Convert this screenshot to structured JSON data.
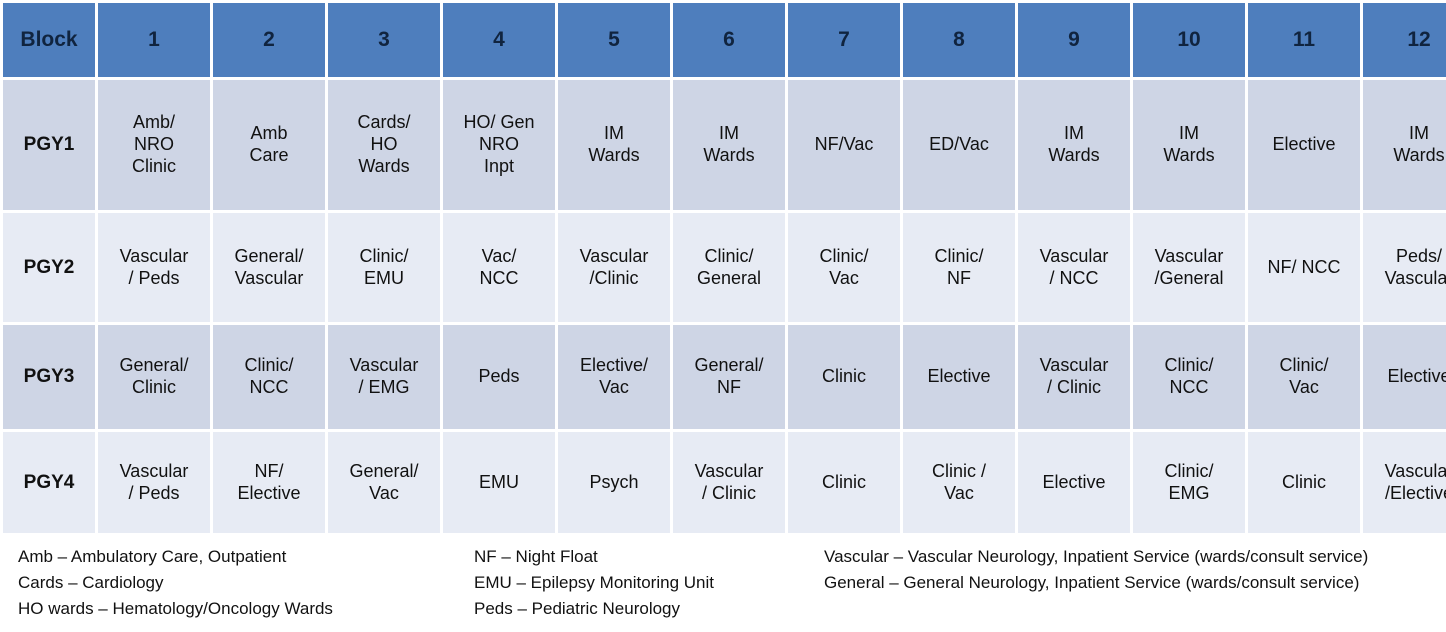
{
  "table": {
    "corner_label": "Block",
    "block_numbers": [
      "1",
      "2",
      "3",
      "4",
      "5",
      "6",
      "7",
      "8",
      "9",
      "10",
      "11",
      "12"
    ],
    "header_bg": "#4e7ebd",
    "band_dark_bg": "#ced5e5",
    "band_light_bg": "#e7ebf4",
    "rows": [
      {
        "label": "PGY1",
        "band": "dark",
        "cells": [
          [
            "Amb/",
            "NRO",
            "Clinic"
          ],
          [
            "Amb",
            "Care"
          ],
          [
            "Cards/",
            "HO",
            "Wards"
          ],
          [
            "HO/ Gen",
            "NRO",
            "Inpt"
          ],
          [
            "IM",
            "Wards"
          ],
          [
            "IM",
            "Wards"
          ],
          [
            "NF/Vac"
          ],
          [
            "ED/Vac"
          ],
          [
            "IM",
            "Wards"
          ],
          [
            "IM",
            "Wards"
          ],
          [
            "Elective"
          ],
          [
            "IM",
            "Wards"
          ]
        ]
      },
      {
        "label": "PGY2",
        "band": "light",
        "cells": [
          [
            "Vascular",
            "/ Peds"
          ],
          [
            "General/",
            "Vascular"
          ],
          [
            "Clinic/",
            "EMU"
          ],
          [
            "Vac/",
            "NCC"
          ],
          [
            "Vascular",
            "/Clinic"
          ],
          [
            "Clinic/",
            "General"
          ],
          [
            "Clinic/",
            "Vac"
          ],
          [
            "Clinic/",
            "NF"
          ],
          [
            "Vascular",
            "/ NCC"
          ],
          [
            "Vascular",
            "/General"
          ],
          [
            "NF/ NCC"
          ],
          [
            "Peds/",
            "Vascular"
          ]
        ]
      },
      {
        "label": "PGY3",
        "band": "dark",
        "cells": [
          [
            "General/",
            "Clinic"
          ],
          [
            "Clinic/",
            "NCC"
          ],
          [
            "Vascular",
            "/ EMG"
          ],
          [
            "Peds"
          ],
          [
            "Elective/",
            "Vac"
          ],
          [
            "General/",
            "NF"
          ],
          [
            "Clinic"
          ],
          [
            "Elective"
          ],
          [
            "Vascular",
            "/ Clinic"
          ],
          [
            "Clinic/",
            "NCC"
          ],
          [
            "Clinic/",
            "Vac"
          ],
          [
            "Elective"
          ]
        ]
      },
      {
        "label": "PGY4",
        "band": "light",
        "cells": [
          [
            "Vascular",
            "/ Peds"
          ],
          [
            "NF/",
            "Elective"
          ],
          [
            "General/",
            "Vac"
          ],
          [
            "EMU"
          ],
          [
            "Psych"
          ],
          [
            "Vascular",
            "/ Clinic"
          ],
          [
            "Clinic"
          ],
          [
            "Clinic /",
            "Vac"
          ],
          [
            "Elective"
          ],
          [
            "Clinic/",
            "EMG"
          ],
          [
            "Clinic"
          ],
          [
            "Vascular",
            "/Elective"
          ]
        ]
      }
    ]
  },
  "legend": {
    "column1": [
      "Amb – Ambulatory Care, Outpatient",
      "Cards – Cardiology",
      "HO wards – Hematology/Oncology Wards"
    ],
    "column2": [
      "NF – Night Float",
      "EMU – Epilepsy Monitoring Unit",
      "Peds – Pediatric Neurology"
    ],
    "column3": [
      "Vascular – Vascular Neurology, Inpatient Service (wards/consult service)",
      "General – General Neurology, Inpatient Service (wards/consult service)"
    ]
  }
}
